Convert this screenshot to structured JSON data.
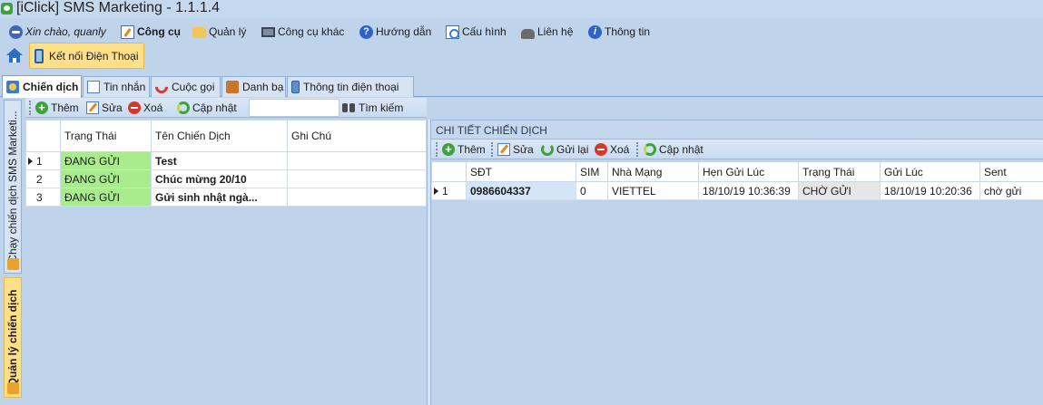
{
  "window": {
    "title": "[iClick] SMS Marketing - 1.1.1.4"
  },
  "menu": [
    {
      "label": "Xin chào, quanly",
      "icon": "user-icon",
      "style": "italic"
    },
    {
      "label": "Công cụ",
      "icon": "tools-icon",
      "style": "bold"
    },
    {
      "label": "Quản lý",
      "icon": "folder-icon",
      "style": "normal"
    },
    {
      "label": "Công cụ khác",
      "icon": "laptop-icon",
      "style": "normal"
    },
    {
      "label": "Hướng dẫn",
      "icon": "help-icon",
      "style": "normal"
    },
    {
      "label": "Cấu hình",
      "icon": "config-icon",
      "style": "normal"
    },
    {
      "label": "Liên hệ",
      "icon": "phone-icon",
      "style": "normal"
    },
    {
      "label": "Thông tin",
      "icon": "info-icon",
      "style": "normal"
    }
  ],
  "ribbon": {
    "connect_label": "Kết nối Điện Thoại"
  },
  "tabs": [
    {
      "label": "Chiến dịch",
      "icon": "campaign-icon",
      "active": true
    },
    {
      "label": "Tin nhắn",
      "icon": "message-icon"
    },
    {
      "label": "Cuộc gọi",
      "icon": "call-icon"
    },
    {
      "label": "Danh bạ",
      "icon": "contacts-icon"
    },
    {
      "label": "Thông tin điện thoại",
      "icon": "phone-info-icon"
    }
  ],
  "side_tabs": [
    {
      "label": "Chạy chiến dịch SMS Marketi...",
      "active": false
    },
    {
      "label": "Quản lý chiến dịch",
      "active": true
    }
  ],
  "left_toolbar": {
    "add": "Thêm",
    "edit": "Sửa",
    "delete": "Xoá",
    "refresh": "Cập nhật",
    "search_value": "",
    "search_label": "Tìm kiếm"
  },
  "campaign_grid": {
    "columns": [
      "Trạng Thái",
      "Tên Chiến Dịch",
      "Ghi Chú"
    ],
    "rows": [
      {
        "index": "1",
        "status": "ĐANG GỬI",
        "name": "Test",
        "note": ""
      },
      {
        "index": "2",
        "status": "ĐANG GỬI",
        "name": "Chúc mừng 20/10",
        "note": ""
      },
      {
        "index": "3",
        "status": "ĐANG GỬI",
        "name": "Gửi sinh nhật ngà...",
        "note": ""
      }
    ]
  },
  "detail": {
    "header": "CHI TIẾT CHIẾN DỊCH",
    "toolbar": {
      "add": "Thêm",
      "edit": "Sửa",
      "resend": "Gửi lại",
      "delete": "Xoá",
      "refresh": "Cập nhật"
    },
    "columns": [
      "SĐT",
      "SIM",
      "Nhà Mạng",
      "Hẹn Gửi Lúc",
      "Trạng Thái",
      "Gửi Lúc",
      "Sent"
    ],
    "rows": [
      {
        "index": "1",
        "phone": "0986604337",
        "sim": "0",
        "carrier": "VIETTEL",
        "scheduled": "18/10/19 10:36:39",
        "status": "CHỜ GỬI",
        "sent_at": "18/10/19 10:20:36",
        "sent": "chờ gửi"
      }
    ]
  },
  "colors": {
    "background": "#bfd3ea",
    "status_sending": "#a8ec8e",
    "active_tab_highlight": "#ffe08a"
  }
}
